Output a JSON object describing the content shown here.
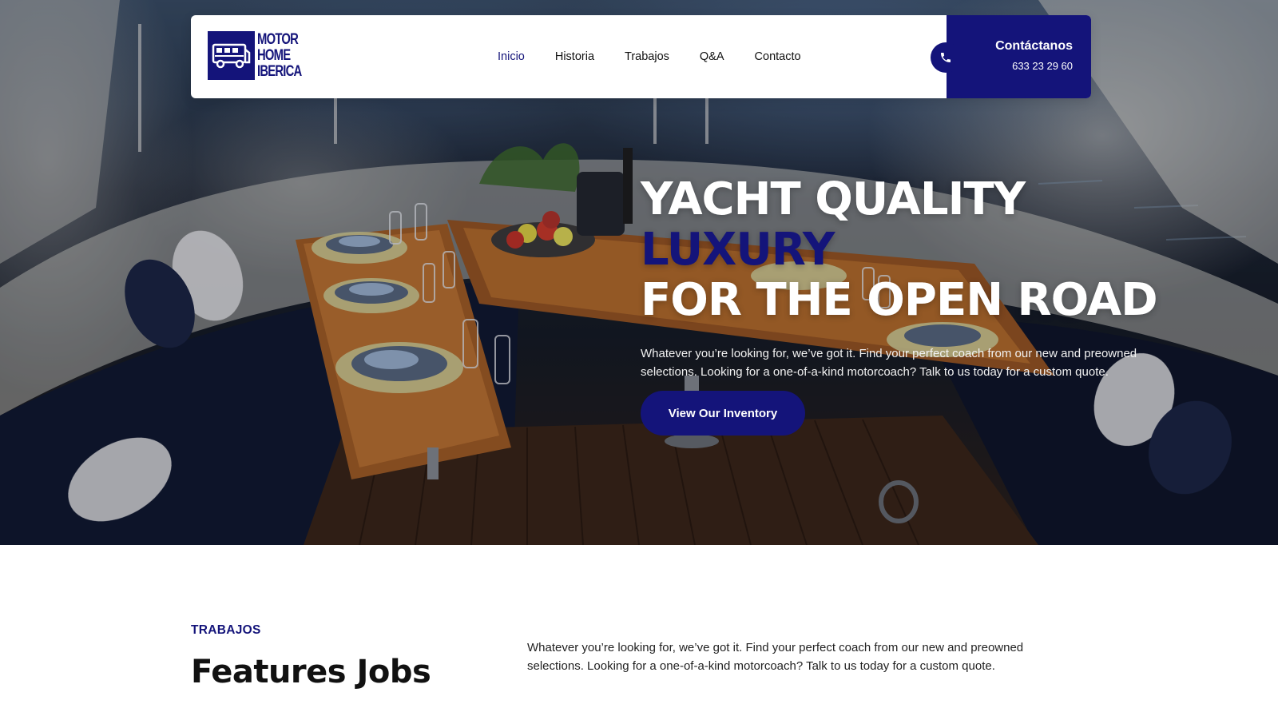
{
  "brand": {
    "logo_lines": [
      "MOTOR",
      "HOME",
      "IBERICA"
    ],
    "color": "#14147a"
  },
  "nav": {
    "items": [
      {
        "label": "Inicio",
        "active": true
      },
      {
        "label": "Historia",
        "active": false
      },
      {
        "label": "Trabajos",
        "active": false
      },
      {
        "label": "Q&A",
        "active": false
      },
      {
        "label": "Contacto",
        "active": false
      }
    ]
  },
  "contact": {
    "title": "Contáctanos",
    "phone": "633 23 29 60",
    "icon": "phone-icon"
  },
  "hero": {
    "headline_part1": "YACHT QUALITY ",
    "headline_accent": "LUXURY",
    "headline_line2": "FOR THE OPEN ROAD",
    "text": "Whatever you’re looking for, we’ve got it. Find your perfect coach from our new and preowned selections. Looking for a one-of-a-kind motorcoach? Talk to us today for a custom quote.",
    "button_label": "View Our Inventory",
    "background": "yacht deck with dining tables"
  },
  "section": {
    "eyebrow": "TRABAJOS",
    "title": "Features Jobs",
    "text": "Whatever you’re looking for, we’ve got it. Find your perfect coach from our new and preowned selections. Looking for a one-of-a-kind motorcoach? Talk to us today for a custom quote."
  }
}
